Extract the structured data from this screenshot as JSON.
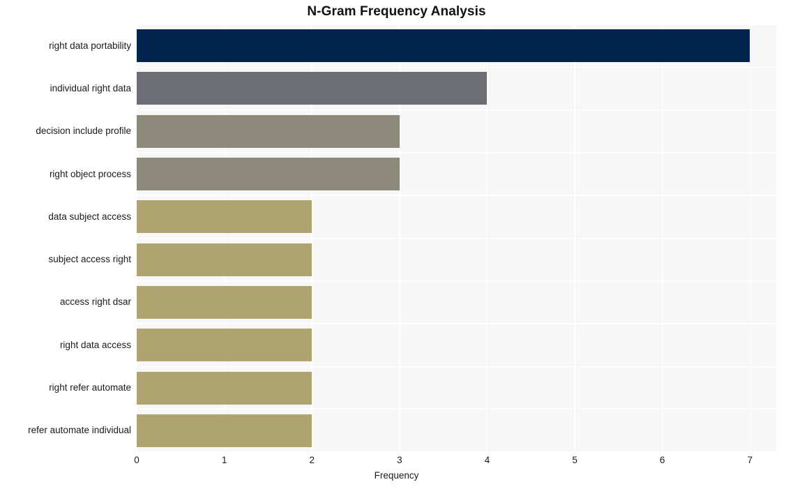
{
  "chart_data": {
    "type": "bar",
    "orientation": "horizontal",
    "title": "N-Gram Frequency Analysis",
    "xlabel": "Frequency",
    "ylabel": "",
    "categories": [
      "right data portability",
      "individual right data",
      "decision include profile",
      "right object process",
      "data subject access",
      "subject access right",
      "access right dsar",
      "right data access",
      "right refer automate",
      "refer automate individual"
    ],
    "values": [
      7,
      4,
      3,
      3,
      2,
      2,
      2,
      2,
      2,
      2
    ],
    "xticks": [
      0,
      1,
      2,
      3,
      4,
      5,
      6,
      7
    ],
    "xlim": [
      0,
      7.3
    ],
    "grid": true,
    "legend": "none",
    "bar_colors": [
      "#042450",
      "#6d6e75",
      "#8e8a7b",
      "#8e8a7b",
      "#aea46f",
      "#aea46f",
      "#aea46f",
      "#aea46f",
      "#aea46f",
      "#aea46f"
    ],
    "plot_background": "#f7f7f7",
    "grid_color": "#ffffff",
    "figure_background": "#ffffff"
  }
}
